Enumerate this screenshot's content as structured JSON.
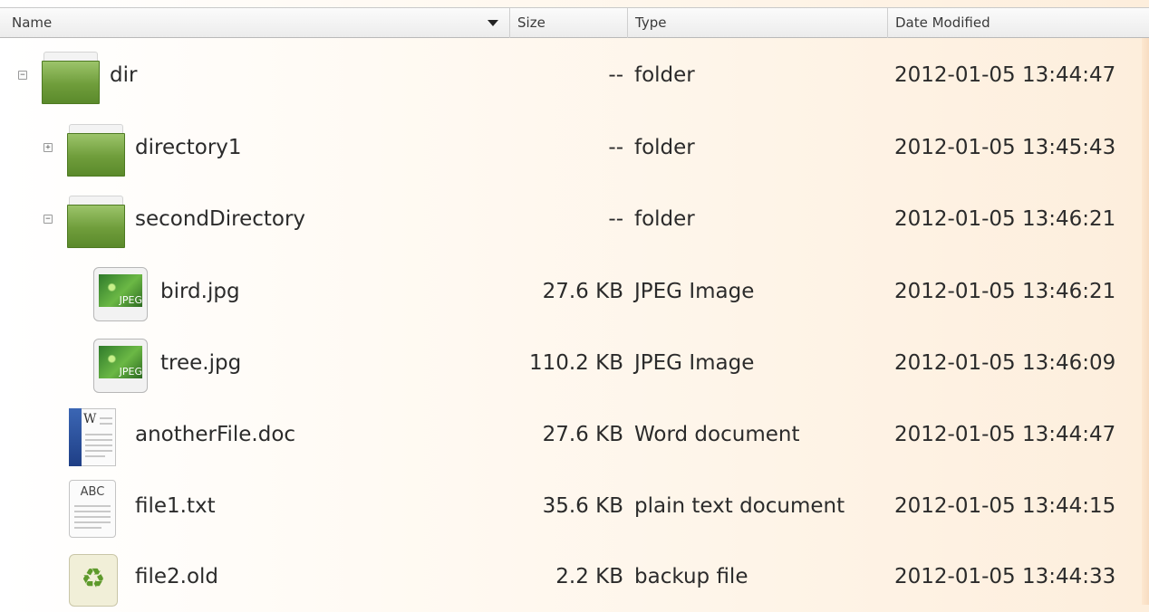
{
  "columns": {
    "name": "Name",
    "size": "Size",
    "type": "Type",
    "date": "Date Modified"
  },
  "rows": [
    {
      "name": "dir",
      "size": "--",
      "type": "folder",
      "date": "2012-01-05 13:44:47",
      "icon": "folder-icon",
      "expander": "−"
    },
    {
      "name": "directory1",
      "size": "--",
      "type": "folder",
      "date": "2012-01-05 13:45:43",
      "icon": "folder-icon",
      "expander": "+"
    },
    {
      "name": "secondDirectory",
      "size": "--",
      "type": "folder",
      "date": "2012-01-05 13:46:21",
      "icon": "folder-icon",
      "expander": "−"
    },
    {
      "name": "bird.jpg",
      "size": "27.6 KB",
      "type": "JPEG Image",
      "date": "2012-01-05 13:46:21",
      "icon": "jpeg-image-icon",
      "icon_label": "JPEG"
    },
    {
      "name": "tree.jpg",
      "size": "110.2 KB",
      "type": "JPEG Image",
      "date": "2012-01-05 13:46:09",
      "icon": "jpeg-image-icon",
      "icon_label": "JPEG"
    },
    {
      "name": "anotherFile.doc",
      "size": "27.6 KB",
      "type": "Word document",
      "date": "2012-01-05 13:44:47",
      "icon": "word-document-icon",
      "icon_label": "W"
    },
    {
      "name": "file1.txt",
      "size": "35.6 KB",
      "type": "plain text document",
      "date": "2012-01-05 13:44:15",
      "icon": "text-document-icon",
      "icon_label": "ABC"
    },
    {
      "name": "file2.old",
      "size": "2.2 KB",
      "type": "backup file",
      "date": "2012-01-05 13:44:33",
      "icon": "backup-file-icon"
    }
  ],
  "colors": {
    "folder": "#6f9d3b",
    "word_spine": "#2b4f9a",
    "recycle": "#5e9a2c"
  }
}
